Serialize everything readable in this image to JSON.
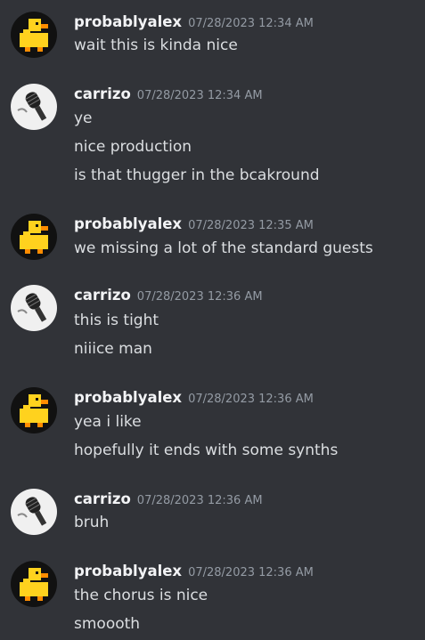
{
  "messages": [
    {
      "author": "probablyalex",
      "avatar": "duck-avatar",
      "timestamp": "07/28/2023 12:34 AM",
      "lines": [
        "wait this is kinda nice"
      ]
    },
    {
      "author": "carrizo",
      "avatar": "microphone-avatar",
      "timestamp": "07/28/2023 12:34 AM",
      "lines": [
        "ye",
        "nice production",
        "is that thugger in the bcakround"
      ]
    },
    {
      "author": "probablyalex",
      "avatar": "duck-avatar",
      "timestamp": "07/28/2023 12:35 AM",
      "lines": [
        "we missing a lot of the standard guests"
      ]
    },
    {
      "author": "carrizo",
      "avatar": "microphone-avatar",
      "timestamp": "07/28/2023 12:36 AM",
      "lines": [
        "this is tight",
        "niiice man"
      ]
    },
    {
      "author": "probablyalex",
      "avatar": "duck-avatar",
      "timestamp": "07/28/2023 12:36 AM",
      "lines": [
        "yea i like",
        "hopefully it ends with some synths"
      ]
    },
    {
      "author": "carrizo",
      "avatar": "microphone-avatar",
      "timestamp": "07/28/2023 12:36 AM",
      "lines": [
        "bruh"
      ]
    },
    {
      "author": "probablyalex",
      "avatar": "duck-avatar",
      "timestamp": "07/28/2023 12:36 AM",
      "lines": [
        "the chorus is nice",
        "smoooth"
      ]
    }
  ],
  "colors": {
    "background": "#313338",
    "username": "#f2f3f5",
    "timestamp": "#949ba4",
    "message_text": "#dbdee1"
  }
}
